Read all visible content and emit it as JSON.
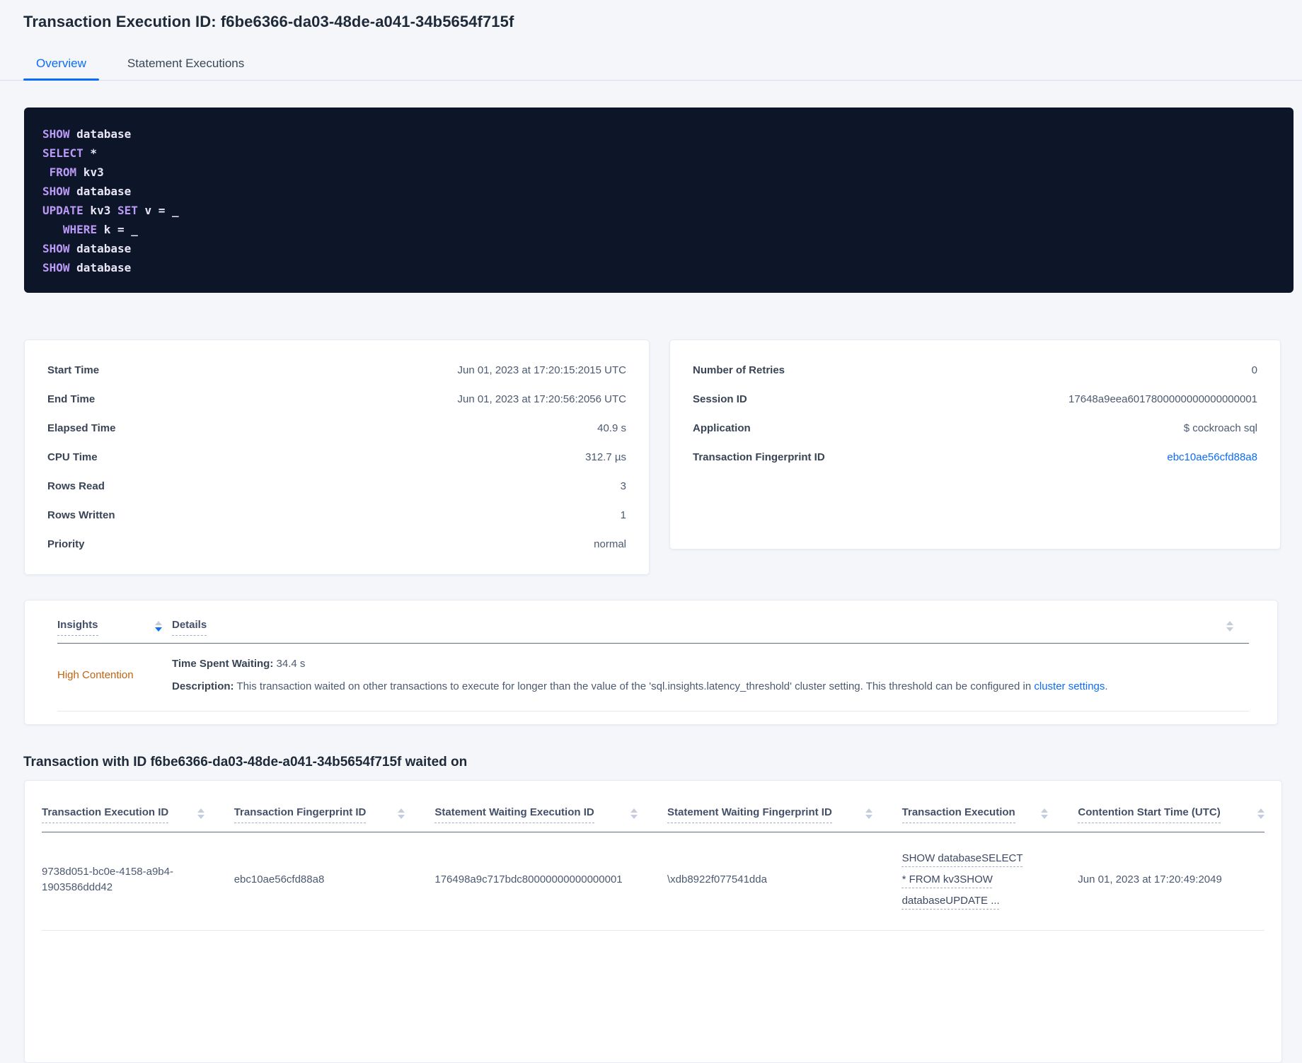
{
  "header": {
    "title": "Transaction Execution ID: f6be6366-da03-48de-a041-34b5654f715f"
  },
  "tabs": [
    {
      "label": "Overview"
    },
    {
      "label": "Statement Executions"
    }
  ],
  "sql": {
    "lines": [
      [
        {
          "type": "kw",
          "text": "SHOW"
        },
        {
          "type": "id",
          "text": " database"
        }
      ],
      [
        {
          "type": "kw",
          "text": "SELECT"
        },
        {
          "type": "id",
          "text": " *"
        }
      ],
      [
        {
          "type": "id",
          "text": " "
        },
        {
          "type": "kw",
          "text": "FROM"
        },
        {
          "type": "id",
          "text": " kv3"
        }
      ],
      [
        {
          "type": "kw",
          "text": "SHOW"
        },
        {
          "type": "id",
          "text": " database"
        }
      ],
      [
        {
          "type": "kw",
          "text": "UPDATE"
        },
        {
          "type": "id",
          "text": " kv3 "
        },
        {
          "type": "kw",
          "text": "SET"
        },
        {
          "type": "id",
          "text": " v = _"
        }
      ],
      [
        {
          "type": "id",
          "text": "   "
        },
        {
          "type": "kw",
          "text": "WHERE"
        },
        {
          "type": "id",
          "text": " k = _"
        }
      ],
      [
        {
          "type": "kw",
          "text": "SHOW"
        },
        {
          "type": "id",
          "text": " database"
        }
      ],
      [
        {
          "type": "kw",
          "text": "SHOW"
        },
        {
          "type": "id",
          "text": " database"
        }
      ]
    ]
  },
  "summary_left": {
    "rows": [
      {
        "label": "Start Time",
        "value": "Jun 01, 2023 at 17:20:15:2015 UTC"
      },
      {
        "label": "End Time",
        "value": "Jun 01, 2023 at 17:20:56:2056 UTC"
      },
      {
        "label": "Elapsed Time",
        "value": "40.9 s"
      },
      {
        "label": "CPU Time",
        "value": "312.7 µs"
      },
      {
        "label": "Rows Read",
        "value": "3"
      },
      {
        "label": "Rows Written",
        "value": "1"
      },
      {
        "label": "Priority",
        "value": "normal"
      }
    ]
  },
  "summary_right": {
    "rows": [
      {
        "label": "Number of Retries",
        "value": "0"
      },
      {
        "label": "Session ID",
        "value": "17648a9eea6017800000000000000001"
      },
      {
        "label": "Application",
        "value": "$ cockroach sql"
      },
      {
        "label": "Transaction Fingerprint ID",
        "value": "ebc10ae56cfd88a8"
      }
    ]
  },
  "insights": {
    "columns": [
      {
        "label": "Insights"
      },
      {
        "label": "Details"
      }
    ],
    "row": {
      "insight": "High Contention",
      "waiting_label": "Time Spent Waiting:",
      "waiting_value": " 34.4 s",
      "description_label": "Description:",
      "description_text": " This transaction waited on other transactions to execute for longer than the value of the 'sql.insights.latency_threshold' cluster setting. This threshold can be configured in ",
      "description_link": "cluster settings",
      "description_suffix": "."
    }
  },
  "waited_on": {
    "heading": "Transaction with ID f6be6366-da03-48de-a041-34b5654f715f waited on",
    "columns": [
      {
        "label": "Transaction Execution ID"
      },
      {
        "label": "Transaction Fingerprint ID"
      },
      {
        "label": "Statement Waiting Execution ID"
      },
      {
        "label": "Statement Waiting Fingerprint ID"
      },
      {
        "label": "Transaction Execution"
      },
      {
        "label": "Contention Start Time (UTC)"
      }
    ],
    "row": {
      "transaction_execution_id": "9738d051-bc0e-4158-a9b4-1903586ddd42",
      "transaction_fingerprint_id": "ebc10ae56cfd88a8",
      "statement_waiting_execution_id": "176498a9c717bdc80000000000000001",
      "statement_waiting_fingerprint_id": "\\xdb8922f077541dda",
      "transaction_execution": "SHOW databaseSELECT * FROM kv3SHOW databaseUPDATE ...",
      "contention_start_time": "Jun 01, 2023 at 17:20:49:2049"
    }
  },
  "colors": {
    "accent_blue": "#0b6cfa",
    "insight_orange": "#c2620f",
    "code_keyword": "#bb9af7",
    "code_background": "#0d1628"
  }
}
